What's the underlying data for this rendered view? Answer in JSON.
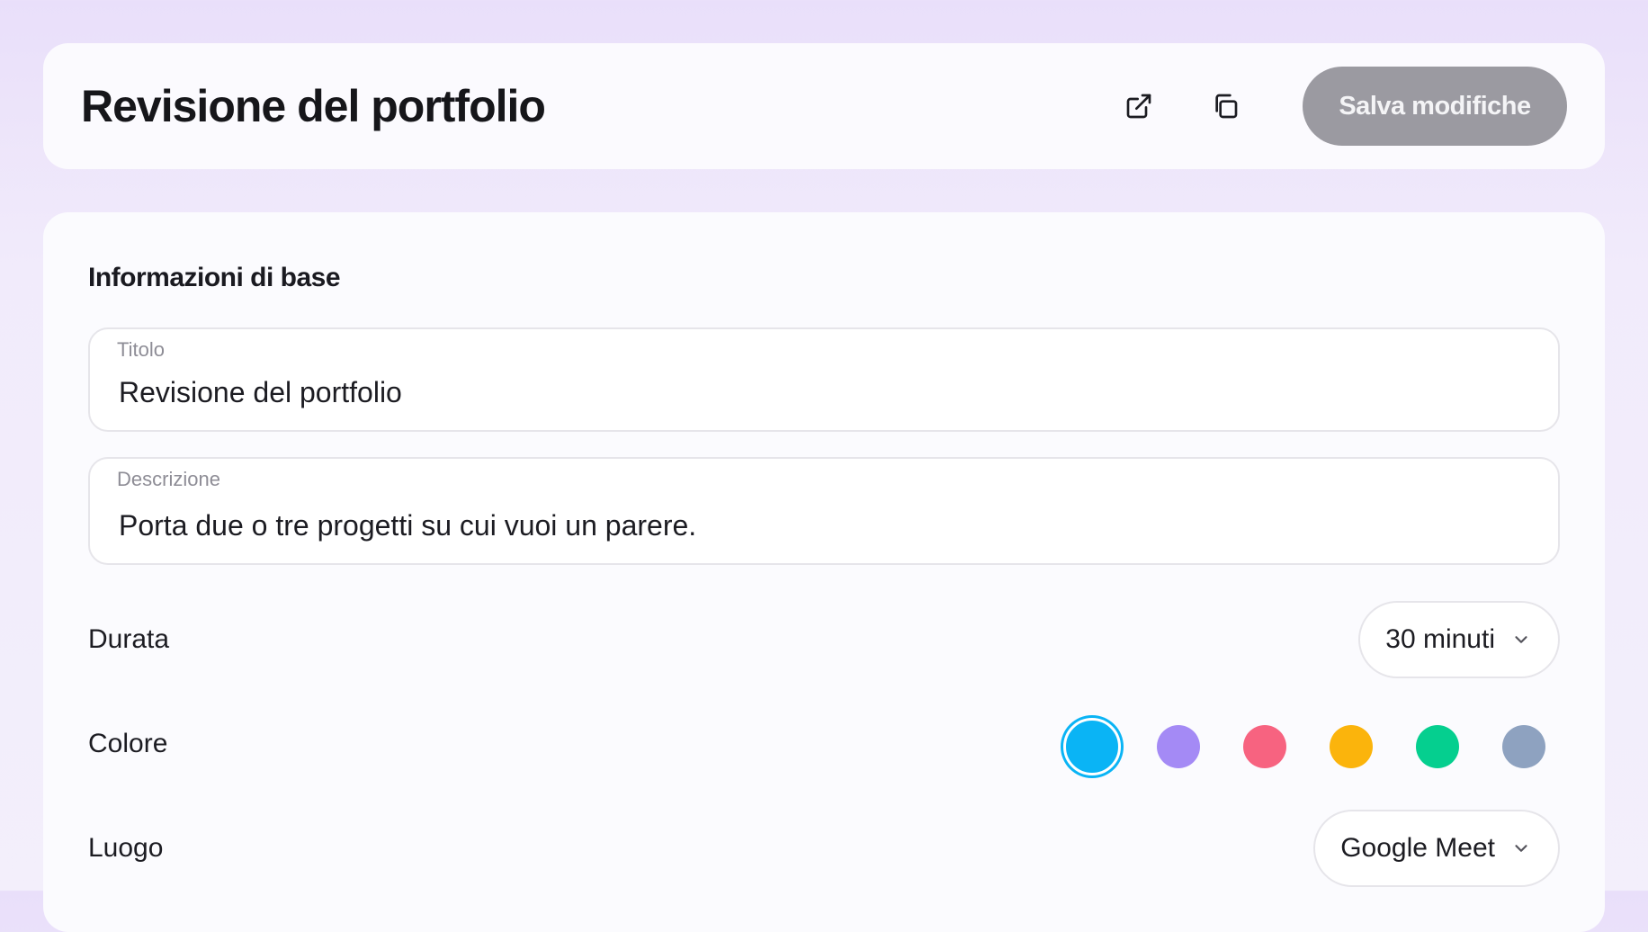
{
  "header": {
    "title": "Revisione del portfolio",
    "save_label": "Salva modifiche"
  },
  "section": {
    "title": "Informazioni di base"
  },
  "fields": {
    "title": {
      "label": "Titolo",
      "value": "Revisione del portfolio"
    },
    "description": {
      "label": "Descrizione",
      "value": "Porta due o tre progetti su cui vuoi un parere."
    }
  },
  "duration": {
    "label": "Durata",
    "selected": "30 minuti"
  },
  "color": {
    "label": "Colore",
    "options": [
      "#0ab4f5",
      "#a48af5",
      "#f76380",
      "#fbb40c",
      "#05cf8f",
      "#8ea2c0"
    ],
    "selected_index": 0
  },
  "location": {
    "label": "Luogo",
    "selected": "Google Meet"
  },
  "icons": {
    "open": "external-link-icon",
    "copy": "copy-icon",
    "chevron": "chevron-down-icon"
  }
}
